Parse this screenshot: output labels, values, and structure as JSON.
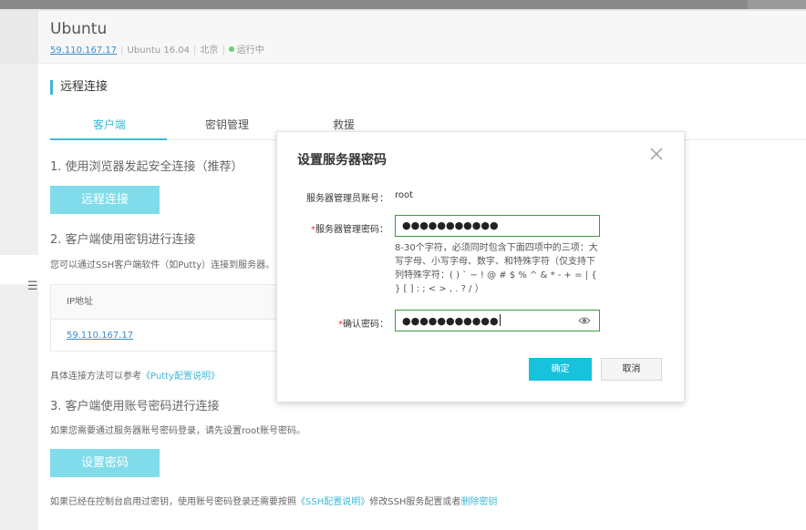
{
  "server": {
    "name": "Ubuntu",
    "ip": "59.110.167.17",
    "os": "Ubuntu  16.04",
    "region": "北京",
    "status": "运行中"
  },
  "section": {
    "title": "远程连接"
  },
  "tabs": [
    {
      "label": "客户端",
      "active": true
    },
    {
      "label": "密钥管理",
      "active": false
    },
    {
      "label": "救援",
      "active": false
    }
  ],
  "steps": {
    "browser": {
      "title": "1. 使用浏览器发起安全连接（推荐）",
      "button": "远程连接"
    },
    "key": {
      "title": "2. 客户端使用密钥进行连接",
      "note": "您可以通过SSH客户端软件（如Putty）连接到服务器。",
      "table_header": "IP地址",
      "table_value": "59.110.167.17",
      "ref_prefix": "具体连接方法可以参考",
      "ref_link": "《Putty配置说明》"
    },
    "password": {
      "title": "3. 客户端使用账号密码进行连接",
      "note": "如果您需要通过服务器账号密码登录，请先设置root账号密码。",
      "button": "设置密码",
      "footer_prefix": "如果已经在控制台启用过密钥，使用账号密码登录还需要按照",
      "footer_link1": "《SSH配置说明》",
      "footer_mid": "修改SSH服务配置或者",
      "footer_link2": "删除密钥"
    }
  },
  "modal": {
    "title": "设置服务器密码",
    "account_label": "服务器管理员账号：",
    "account_value": "root",
    "password_label": "服务器管理密码：",
    "password_value": "●●●●●●●●●●●",
    "hint": "8-30个字符，必须同时包含下面四项中的三项：大写字母、小写字母、数字、和特殊字符（仅支持下列特殊字符：( ) ` ~ ! @ # $ % ^ & * - + = | { } [ ] : ; < > , . ? / ）",
    "confirm_label": "确认密码：",
    "confirm_value": "●●●●●●●●●●●",
    "required_mark": "*",
    "ok_button": "确定",
    "cancel_button": "取消"
  },
  "colors": {
    "accent": "#3fb8d6",
    "button_light": "#80dceb",
    "ok_button": "#16c2dc",
    "field_border": "#3a9d3a",
    "status_dot": "#69d07a",
    "required": "#e33333"
  },
  "icons": {
    "close": "close-icon",
    "eye": "eye-icon",
    "menu": "menu-icon"
  }
}
